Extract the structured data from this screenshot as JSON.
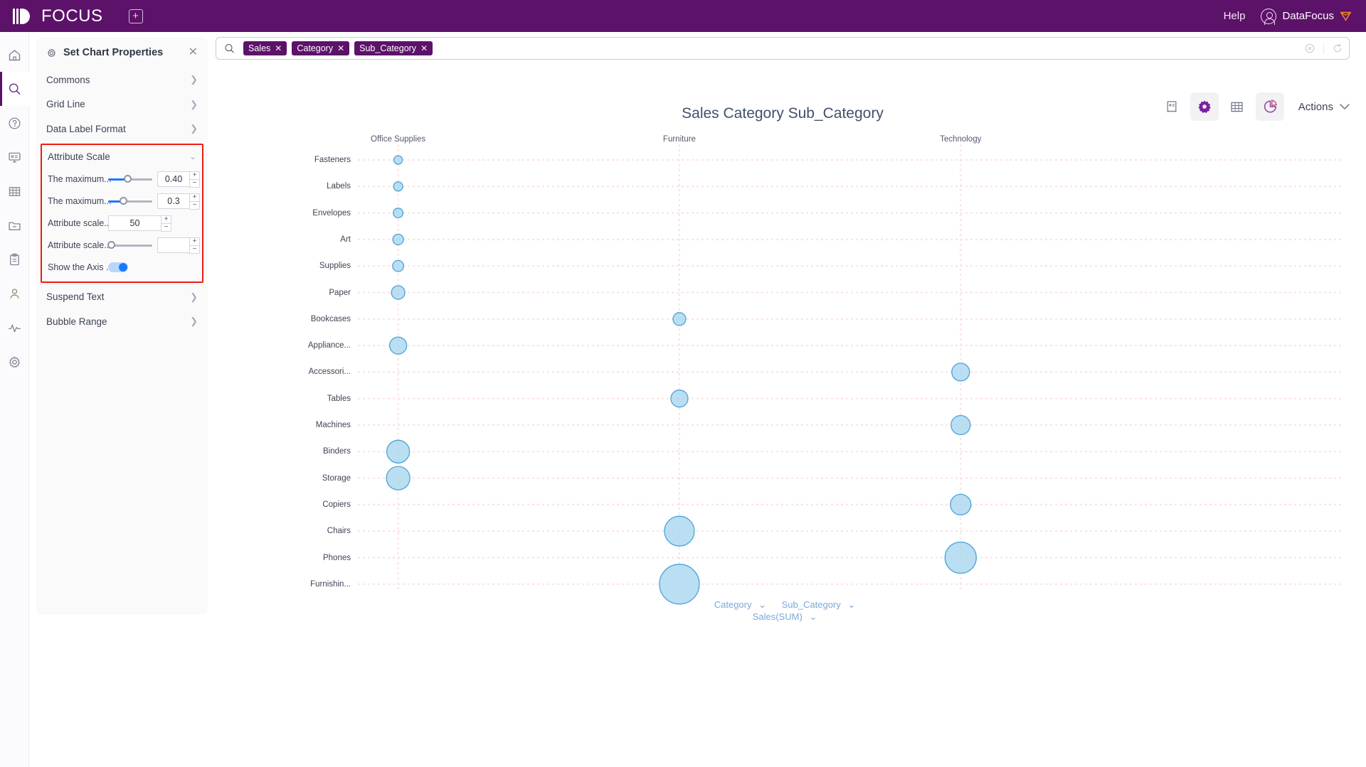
{
  "header": {
    "logo_text": "FOCUS",
    "new_tab_icon": "plus-square-icon",
    "help_label": "Help",
    "user_name": "DataFocus",
    "avatar_icon": "user-circle-icon",
    "badge_icon": "gem-icon",
    "bar_color": "#5c1269"
  },
  "rail": {
    "items": [
      {
        "icon": "home-icon",
        "active": false
      },
      {
        "icon": "search-icon",
        "active": true
      },
      {
        "icon": "question-circle-icon",
        "active": false
      },
      {
        "icon": "presentation-icon",
        "active": false
      },
      {
        "icon": "table-grid-icon",
        "active": false
      },
      {
        "icon": "folder-icon",
        "active": false
      },
      {
        "icon": "clipboard-icon",
        "active": false
      },
      {
        "icon": "user-icon",
        "active": false
      },
      {
        "icon": "activity-pulse-icon",
        "active": false
      },
      {
        "icon": "gear-icon",
        "active": false
      }
    ]
  },
  "panel": {
    "title": "Set Chart Properties",
    "settings_icon": "gear-icon",
    "close_icon": "close-icon",
    "highlight_color": "#f01c14",
    "rows_top": [
      {
        "label": "Commons"
      },
      {
        "label": "Grid Line"
      },
      {
        "label": "Data Label Format"
      }
    ],
    "attribute_scale": {
      "label": "Attribute Scale",
      "expanded": true,
      "controls": [
        {
          "label": "The maximum...",
          "type": "slider-number",
          "value": "0.40",
          "slider_pct": 44
        },
        {
          "label": "The maximum...",
          "type": "slider-number",
          "value": "0.3",
          "slider_pct": 34
        },
        {
          "label": "Attribute scale...",
          "type": "number",
          "value": "50"
        },
        {
          "label": "Attribute scale...",
          "type": "slider-number",
          "value": "",
          "slider_pct": 0
        },
        {
          "label": "Show the Axis ...",
          "type": "toggle",
          "value": "on"
        }
      ]
    },
    "rows_bottom": [
      {
        "label": "Suspend Text"
      },
      {
        "label": "Bubble Range"
      }
    ]
  },
  "search": {
    "search_icon": "search-icon",
    "chips": [
      "Sales",
      "Category",
      "Sub_Category"
    ],
    "clear_icon": "clear-circle-icon",
    "refresh_icon": "refresh-icon"
  },
  "toolbar": {
    "buttons": [
      {
        "icon": "receipt-icon",
        "active": false
      },
      {
        "icon": "gear-icon",
        "active": true
      },
      {
        "icon": "table-grid-icon",
        "active": false
      },
      {
        "icon": "pie-chart-icon",
        "active": true
      }
    ],
    "actions_label": "Actions",
    "actions_chevron": "chevron-down-icon"
  },
  "chart_data": {
    "type": "scatter",
    "title": "Sales Category Sub_Category",
    "xlabel": "Category / Sub_Category",
    "ylabel": "Sales(SUM)",
    "categories": [
      "Office Supplies",
      "Furniture",
      "Technology"
    ],
    "category_x_pct": [
      16.1,
      40.9,
      65.7
    ],
    "rows": [
      "Fasteners",
      "Labels",
      "Envelopes",
      "Art",
      "Supplies",
      "Paper",
      "Bookcases",
      "Appliance...",
      "Accessori...",
      "Tables",
      "Machines",
      "Binders",
      "Storage",
      "Copiers",
      "Chairs",
      "Phones",
      "Furnishin..."
    ],
    "points": [
      {
        "row": "Fasteners",
        "category": "Office Supplies",
        "r": 6.0
      },
      {
        "row": "Labels",
        "category": "Office Supplies",
        "r": 6.5
      },
      {
        "row": "Envelopes",
        "category": "Office Supplies",
        "r": 6.8
      },
      {
        "row": "Art",
        "category": "Office Supplies",
        "r": 7.5
      },
      {
        "row": "Supplies",
        "category": "Office Supplies",
        "r": 7.8
      },
      {
        "row": "Paper",
        "category": "Office Supplies",
        "r": 9.5
      },
      {
        "row": "Bookcases",
        "category": "Furniture",
        "r": 9.0
      },
      {
        "row": "Appliance...",
        "category": "Office Supplies",
        "r": 12.0
      },
      {
        "row": "Accessori...",
        "category": "Technology",
        "r": 12.5
      },
      {
        "row": "Tables",
        "category": "Furniture",
        "r": 12.0
      },
      {
        "row": "Machines",
        "category": "Technology",
        "r": 13.5
      },
      {
        "row": "Binders",
        "category": "Office Supplies",
        "r": 16.0
      },
      {
        "row": "Storage",
        "category": "Office Supplies",
        "r": 16.5
      },
      {
        "row": "Copiers",
        "category": "Technology",
        "r": 14.5
      },
      {
        "row": "Chairs",
        "category": "Furniture",
        "r": 21.0
      },
      {
        "row": "Phones",
        "category": "Technology",
        "r": 22.0
      },
      {
        "row": "Furnishin...",
        "category": "Furniture",
        "r": 28.0
      }
    ],
    "bubble_fill": "#aed8f0",
    "bubble_stroke": "#4ba3d8",
    "grid": true,
    "gridline_color": "#fbe3e3",
    "legend": "none"
  },
  "footer_axis": {
    "category_label": "Category",
    "sub_category_label": "Sub_Category",
    "measure_label": "Sales(SUM)",
    "chevron": "chevron-down-icon"
  }
}
